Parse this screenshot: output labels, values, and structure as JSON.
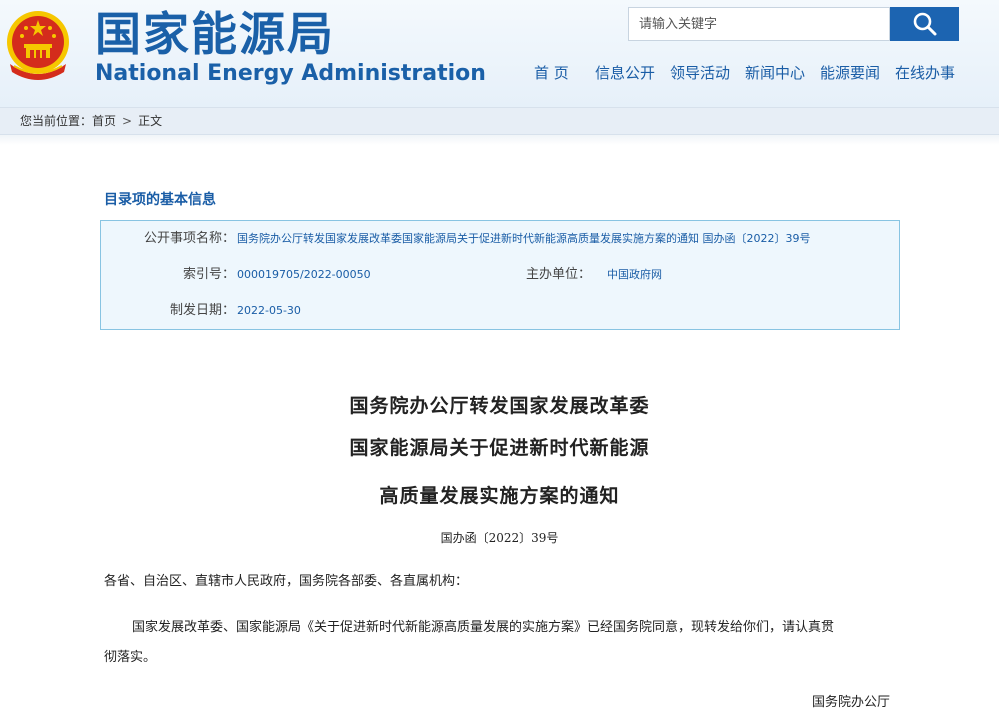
{
  "header": {
    "logo_cn": "国家能源局",
    "logo_en": "National Energy Administration",
    "search_placeholder": "请输入关键字",
    "nav": [
      {
        "label": "首  页",
        "id": "home"
      },
      {
        "label": "信息公开",
        "id": "info"
      },
      {
        "label": "领导活动",
        "id": "leaders"
      },
      {
        "label": "新闻中心",
        "id": "news"
      },
      {
        "label": "能源要闻",
        "id": "energy-news"
      },
      {
        "label": "在线办事",
        "id": "services"
      }
    ]
  },
  "breadcrumb": {
    "prefix": "您当前位置：",
    "home": "首页",
    "sep": ">",
    "current": "正文"
  },
  "info": {
    "section_title": "目录项的基本信息",
    "rows": {
      "item_name_label": "公开事项名称：",
      "item_name_value": "国务院办公厅转发国家发展改革委国家能源局关于促进新时代新能源高质量发展实施方案的通知 国办函〔2022〕39号",
      "index_label": "索引号：",
      "index_value": "000019705/2022-00050",
      "host_label": "主办单位：",
      "host_value": "中国政府网",
      "date_label": "制发日期：",
      "date_value": "2022-05-30"
    }
  },
  "document": {
    "title_lines": [
      "国务院办公厅转发国家发展改革委",
      "国家能源局关于促进新时代新能源",
      "高质量发展实施方案的通知"
    ],
    "number": "国办函〔2022〕39号",
    "salutation": "各省、自治区、直辖市人民政府，国务院各部委、各直属机构：",
    "body_line1": "国家发展改革委、国家能源局《关于促进新时代新能源高质量发展的实施方案》已经国务院同意，现转发给你们，请认真贯",
    "body_line2": "彻落实。",
    "signature": "国务院办公厅"
  },
  "colors": {
    "brand_blue": "#1a60a8",
    "search_button": "#1c64b1",
    "info_border": "#88c4e2",
    "info_bg": "#eef7fd",
    "emblem_red": "#d42c1c",
    "emblem_gold": "#f6c700"
  },
  "icons": {
    "emblem": "national-emblem-icon",
    "search": "search-icon"
  }
}
